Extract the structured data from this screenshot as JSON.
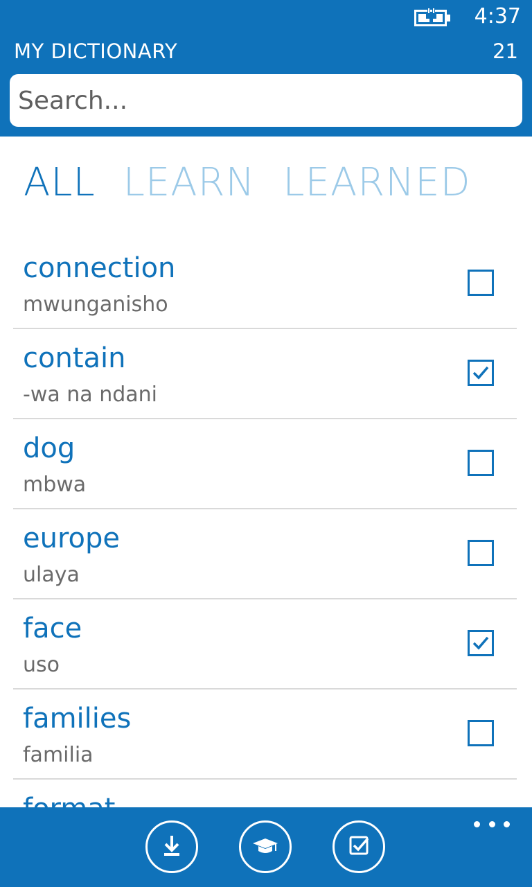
{
  "status_bar": {
    "time": "4:37",
    "battery_icon": "battery-charging-icon"
  },
  "header": {
    "title": "MY DICTIONARY",
    "count": "21"
  },
  "search": {
    "placeholder": "Search..."
  },
  "tabs": [
    {
      "label": "ALL",
      "active": true
    },
    {
      "label": "LEARN",
      "active": false
    },
    {
      "label": "LEARNED",
      "active": false
    }
  ],
  "entries": [
    {
      "word": "connection",
      "translation": "mwunganisho",
      "checked": false
    },
    {
      "word": "contain",
      "translation": "-wa na ndani",
      "checked": true
    },
    {
      "word": "dog",
      "translation": "mbwa",
      "checked": false
    },
    {
      "word": "europe",
      "translation": "ulaya",
      "checked": false
    },
    {
      "word": "face",
      "translation": "uso",
      "checked": true
    },
    {
      "word": "families",
      "translation": "familia",
      "checked": false
    },
    {
      "word": "format",
      "translation": "",
      "checked": false
    }
  ],
  "app_bar": {
    "buttons": [
      {
        "icon": "download-icon"
      },
      {
        "icon": "graduation-cap-icon"
      },
      {
        "icon": "checkbox-icon"
      }
    ],
    "more_icon": "more-dots-icon"
  },
  "colors": {
    "accent": "#0f72ba",
    "inactive_tab": "#9ccae8",
    "secondary_text": "#6a6a6a",
    "divider": "#d9d9d9"
  }
}
